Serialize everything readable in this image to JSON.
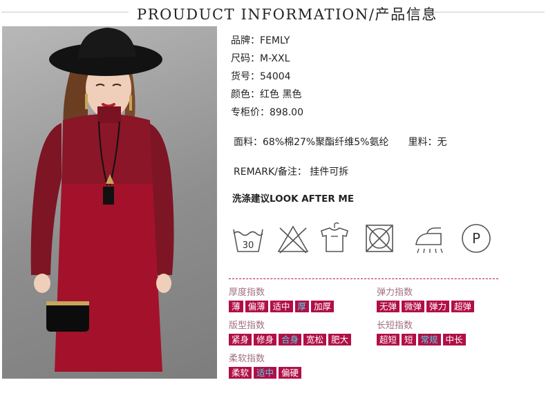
{
  "header": {
    "title": "PROUDUCT INFORMATION/产品信息"
  },
  "specs": {
    "brand": "品牌：FEMLY",
    "size": "尺码：M-XXL",
    "item_no": "货号：54004",
    "color": "颜色：红色 黑色",
    "price": "专柜价：898.00"
  },
  "fabric": {
    "material": "面料：68%棉27%聚酯纤维5%氨纶",
    "lining": "里料：无"
  },
  "remark": "REMARK/备注： 挂件可拆",
  "wash": {
    "title": "洗涤建议LOOK AFTER ME",
    "icons": [
      "wash-30-icon",
      "no-bleach-icon",
      "hang-dry-icon",
      "no-tumble-dry-icon",
      "steam-iron-icon",
      "dry-clean-p-icon"
    ],
    "wash_temp": "30",
    "dryclean_letter": "P"
  },
  "indices": {
    "thickness": {
      "title": "厚度指数",
      "options": [
        "薄",
        "偏薄",
        "适中",
        "厚",
        "加厚"
      ],
      "selected": 3
    },
    "elasticity": {
      "title": "弹力指数",
      "options": [
        "无弹",
        "微弹",
        "弹力",
        "超弹"
      ],
      "selected": -1
    },
    "fit": {
      "title": "版型指数",
      "options": [
        "紧身",
        "修身",
        "合身",
        "宽松",
        "肥大"
      ],
      "selected": 2
    },
    "length": {
      "title": "长短指数",
      "options": [
        "超短",
        "短",
        "常规",
        "中长"
      ],
      "selected": 2
    },
    "softness": {
      "title": "柔软指数",
      "options": [
        "柔软",
        "适中",
        "偏硬"
      ],
      "selected": 1
    }
  },
  "colors": {
    "accent": "#b10f47",
    "selected_text": "#4fd8e8",
    "dress_red": "#a3122a"
  }
}
